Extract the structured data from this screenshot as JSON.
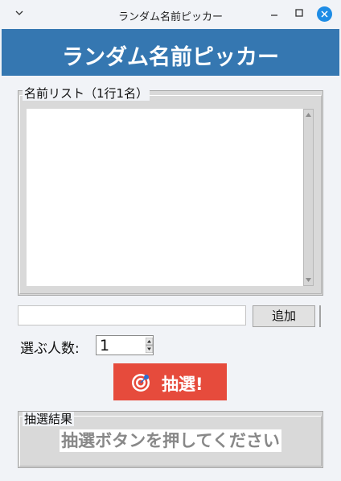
{
  "window": {
    "title": "ランダム名前ピッカー"
  },
  "header": {
    "title": "ランダム名前ピッカー",
    "bg_color": "#3577b1"
  },
  "name_list": {
    "legend": "名前リスト（1行1名）",
    "content": ""
  },
  "add_row": {
    "input_value": "",
    "add_label": "追加"
  },
  "count": {
    "label": "選ぶ人数:",
    "value": "1"
  },
  "draw": {
    "label": "抽選!",
    "icon": "target-icon",
    "color": "#e64b3c"
  },
  "result": {
    "legend": "抽選結果",
    "placeholder": "抽選ボタンを押してください"
  }
}
